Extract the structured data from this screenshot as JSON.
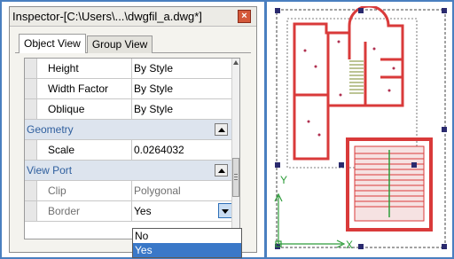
{
  "inspector": {
    "title": "Inspector-[C:\\Users\\...\\dwgfil_a.dwg*]",
    "close_glyph": "×",
    "tabs": [
      {
        "label": "Object View",
        "active": true
      },
      {
        "label": "Group View",
        "active": false
      }
    ],
    "properties": {
      "height": {
        "name": "Height",
        "value": "By Style"
      },
      "width_factor": {
        "name": "Width Factor",
        "value": "By Style"
      },
      "oblique": {
        "name": "Oblique",
        "value": "By Style"
      }
    },
    "geometry": {
      "label": "Geometry",
      "scale": {
        "name": "Scale",
        "value": "0.0264032"
      }
    },
    "viewport": {
      "label": "View Port",
      "clip": {
        "name": "Clip",
        "value": "Polygonal"
      },
      "border": {
        "name": "Border",
        "value": "Yes"
      }
    },
    "border_dropdown": {
      "options": [
        "No",
        "Yes"
      ],
      "selected": "Yes"
    }
  },
  "colors": {
    "frame_blue": "#4a7fc0",
    "category_bg": "#dde4ee",
    "category_text": "#2f5f9e",
    "selection_blue": "#3a78c8",
    "wall_red": "#d93a3a",
    "grip_navy": "#2a2a6e",
    "axis_green": "#2e9c3a"
  },
  "icons": {
    "close": "close-icon",
    "collapse": "chevron-up-icon",
    "dropdown": "chevron-down-icon",
    "scroll_up": "arrow-up-icon"
  },
  "drawing": {
    "axis_y_label": "Y",
    "axis_x_label": "X"
  }
}
